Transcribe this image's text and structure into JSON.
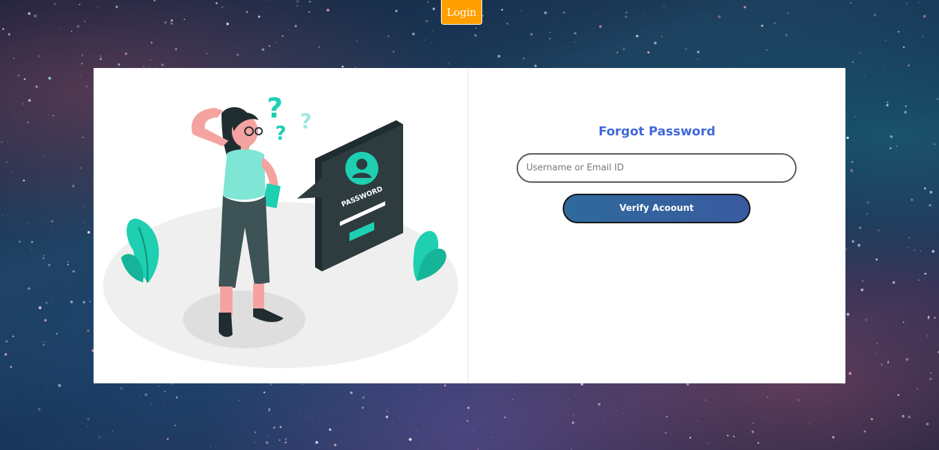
{
  "header": {
    "login_label": "Login"
  },
  "form": {
    "title": "Forgot Password",
    "username_placeholder": "Username or Email ID",
    "username_value": "",
    "verify_label": "Verify Acoount"
  },
  "illustration": {
    "panel_text": "PASSWORD"
  },
  "colors": {
    "login_button": "#ff9f00",
    "title": "#4169d8",
    "verify_button_start": "#2e6a9c",
    "verify_button_end": "#3a5aa0",
    "illustration_teal": "#1ecfb1",
    "panel_dark": "#2e3c40"
  }
}
